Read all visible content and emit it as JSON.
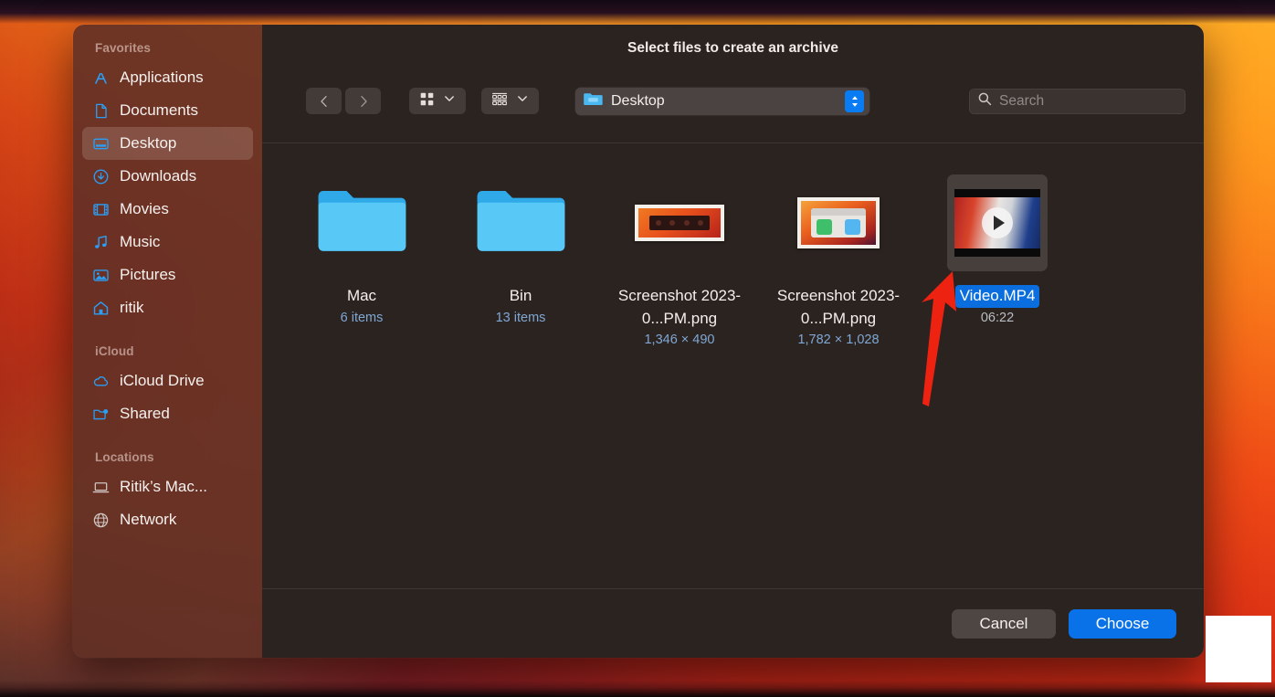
{
  "window": {
    "title": "Select files to create an archive"
  },
  "sidebar": {
    "sections": [
      {
        "label": "Favorites",
        "items": [
          {
            "label": "Applications",
            "icon": "applications-icon",
            "selected": false
          },
          {
            "label": "Documents",
            "icon": "document-icon",
            "selected": false
          },
          {
            "label": "Desktop",
            "icon": "desktop-icon",
            "selected": true
          },
          {
            "label": "Downloads",
            "icon": "download-icon",
            "selected": false
          },
          {
            "label": "Movies",
            "icon": "movies-icon",
            "selected": false
          },
          {
            "label": "Music",
            "icon": "music-icon",
            "selected": false
          },
          {
            "label": "Pictures",
            "icon": "pictures-icon",
            "selected": false
          },
          {
            "label": "ritik",
            "icon": "home-icon",
            "selected": false
          }
        ]
      },
      {
        "label": "iCloud",
        "items": [
          {
            "label": "iCloud Drive",
            "icon": "cloud-icon",
            "selected": false
          },
          {
            "label": "Shared",
            "icon": "shared-folder-icon",
            "selected": false
          }
        ]
      },
      {
        "label": "Locations",
        "items": [
          {
            "label": "Ritik’s Mac...",
            "icon": "laptop-icon",
            "selected": false
          },
          {
            "label": "Network",
            "icon": "globe-icon",
            "selected": false
          }
        ]
      }
    ]
  },
  "toolbar": {
    "back_icon": "chevron-left-icon",
    "forward_icon": "chevron-right-icon",
    "view_icon": "grid-view-icon",
    "view_chevron_icon": "chevron-down-icon",
    "group_icon": "group-by-icon",
    "group_chevron_icon": "chevron-down-icon",
    "path": {
      "label": "Desktop",
      "folder_icon": "folder-icon",
      "stepper_icon": "up-down-stepper-icon"
    },
    "search": {
      "placeholder": "Search",
      "icon": "search-icon"
    }
  },
  "files": [
    {
      "name": "Mac",
      "meta": "6 items",
      "kind": "folder",
      "selected": false,
      "icon": "folder-icon"
    },
    {
      "name": "Bin",
      "meta": "13 items",
      "kind": "folder",
      "selected": false,
      "icon": "folder-icon"
    },
    {
      "name": "Screenshot 2023-0...PM.png",
      "meta": "1,346 × 490",
      "kind": "image",
      "selected": false,
      "icon": "image-thumbnail"
    },
    {
      "name": "Screenshot 2023-0...PM.png",
      "meta": "1,782 × 1,028",
      "kind": "image",
      "selected": false,
      "icon": "image-thumbnail"
    },
    {
      "name": "Video.MP4",
      "meta": "06:22",
      "kind": "video",
      "selected": true,
      "icon": "video-thumbnail"
    }
  ],
  "footer": {
    "cancel_label": "Cancel",
    "choose_label": "Choose"
  },
  "annotations": {
    "arrow": {
      "color": "#ee2211",
      "target": "Video.MP4"
    }
  },
  "colors": {
    "accent_blue": "#0a72e8",
    "selection_blue": "#0a6ede",
    "sidebar_bg": "#603026",
    "content_bg": "#2b2320",
    "meta_text": "#7fa7d4"
  }
}
